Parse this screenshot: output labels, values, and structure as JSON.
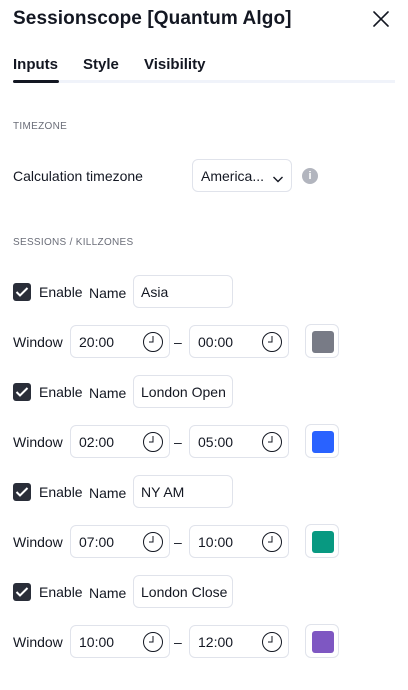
{
  "dialog": {
    "title": "Sessionscope [Quantum Algo]"
  },
  "tabs": [
    {
      "label": "Inputs",
      "active": true
    },
    {
      "label": "Style"
    },
    {
      "label": "Visibility"
    }
  ],
  "timezone_section": {
    "heading": "TIMEZONE",
    "label": "Calculation timezone",
    "value": "America..."
  },
  "sessions_section": {
    "heading": "SESSIONS / KILLZONES"
  },
  "labels": {
    "enable": "Enable",
    "name": "Name",
    "window": "Window",
    "dash": "–"
  },
  "sessions": [
    {
      "enabled": true,
      "name": "Asia",
      "start": "20:00",
      "end": "00:00",
      "color": "#787b86"
    },
    {
      "enabled": true,
      "name": "London Open",
      "start": "02:00",
      "end": "05:00",
      "color": "#2962ff"
    },
    {
      "enabled": true,
      "name": "NY AM",
      "start": "07:00",
      "end": "10:00",
      "color": "#089981"
    },
    {
      "enabled": true,
      "name": "London Close",
      "start": "10:00",
      "end": "12:00",
      "color": "#7e57c2"
    }
  ]
}
